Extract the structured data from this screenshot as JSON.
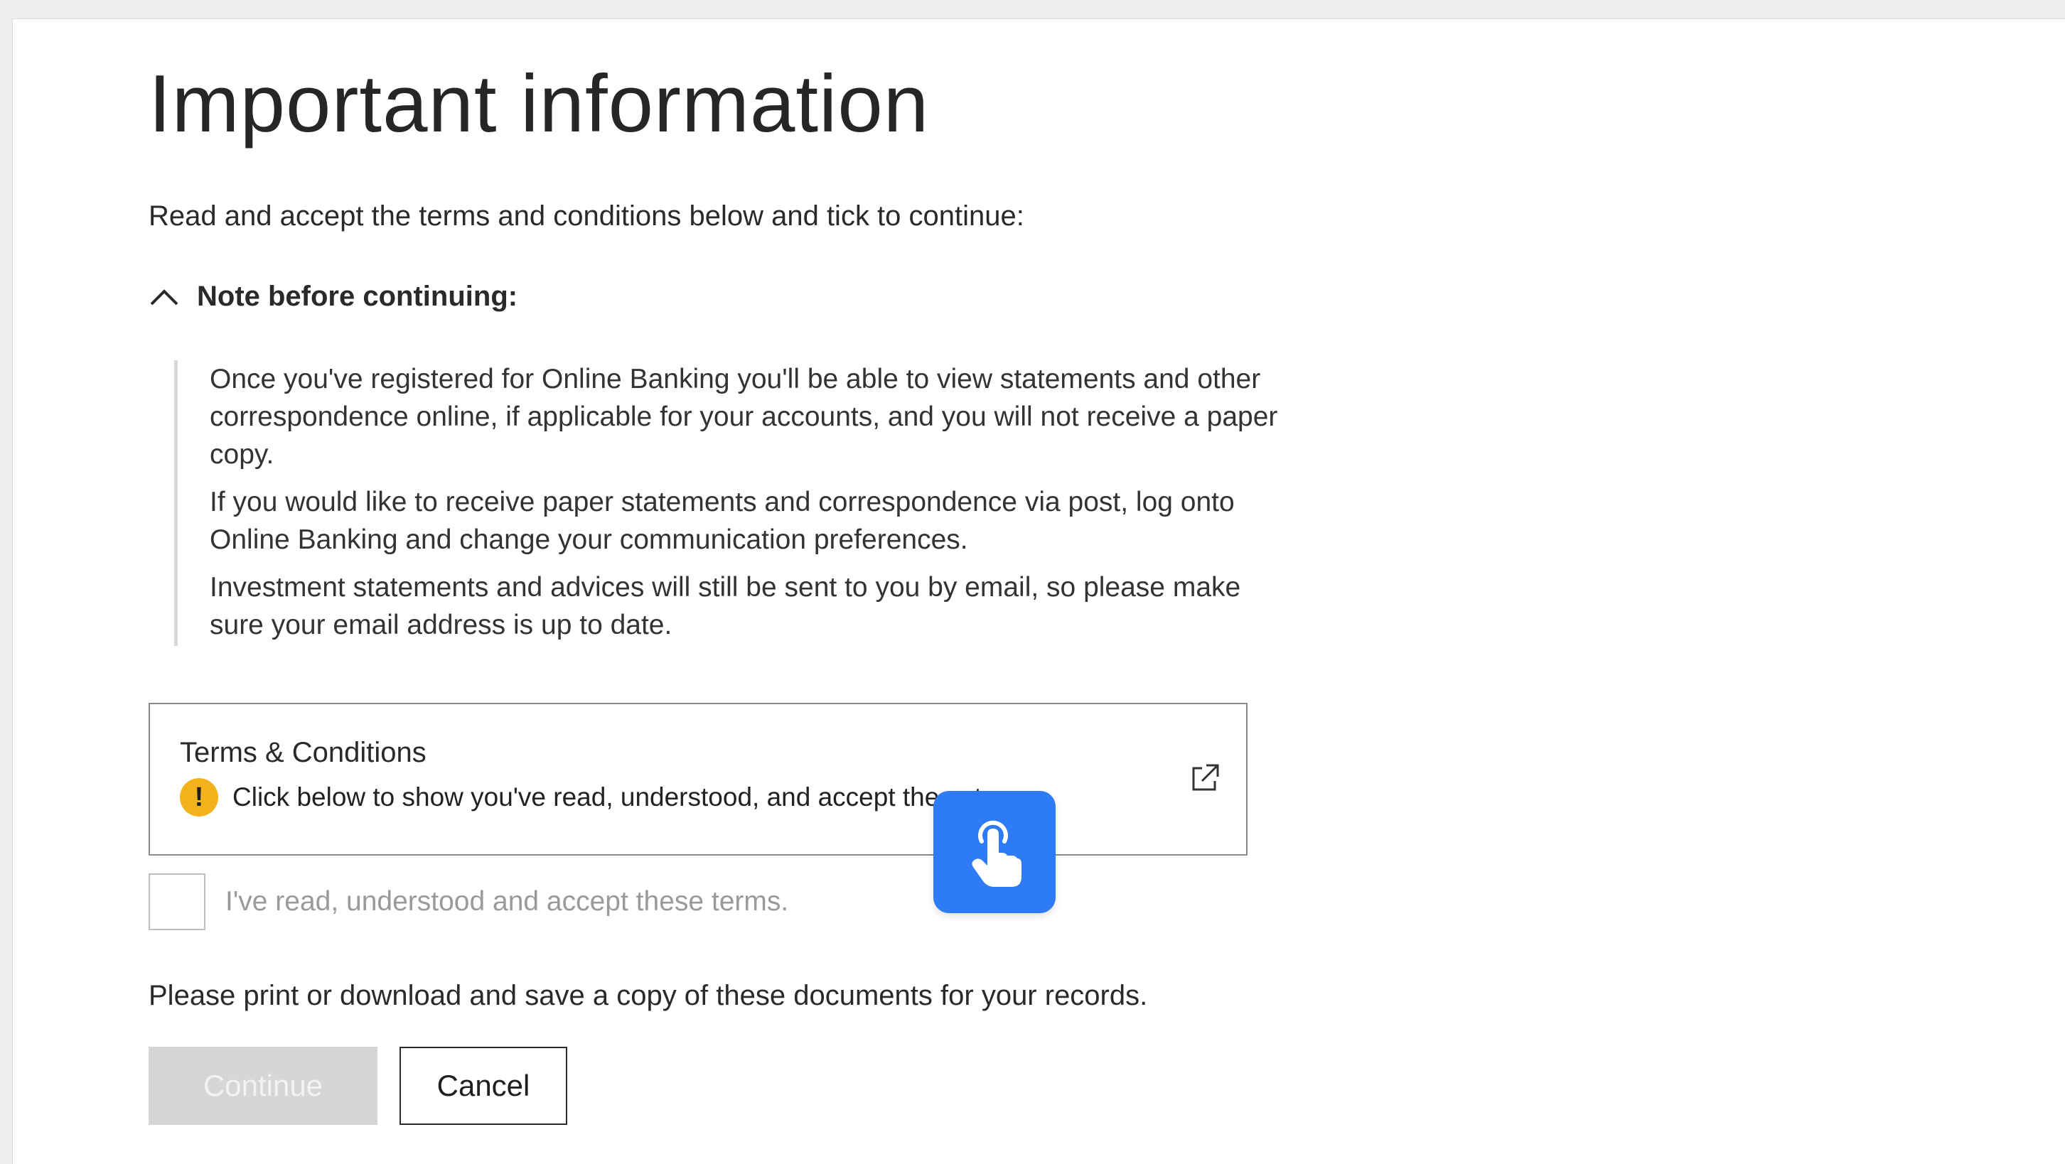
{
  "page": {
    "title": "Important information",
    "intro": "Read and accept the terms and conditions below and tick to continue:"
  },
  "note": {
    "label": "Note before continuing:",
    "expanded": true,
    "paragraphs": [
      "Once you've registered for Online Banking you'll be able to view statements and other correspondence online, if applicable for your accounts, and you will not receive a paper copy.",
      "If you would like to receive paper statements and correspondence via post, log onto Online Banking and change your communication preferences.",
      "Investment statements and advices will still be sent to you by email, so please make sure your email address is up to date."
    ]
  },
  "terms": {
    "title": "Terms & Conditions",
    "warning": "Click below to show you've read, understood, and accept these terms",
    "warning_icon": "exclamation-icon",
    "link_icon": "external-link-icon"
  },
  "accept": {
    "label": "I've read, understood and accept these terms.",
    "checked": false
  },
  "records_note": "Please print or download and save a copy of these documents for your records.",
  "buttons": {
    "continue_label": "Continue",
    "continue_enabled": false,
    "cancel_label": "Cancel"
  },
  "colors": {
    "warning": "#f2b21b",
    "tap_hint": "#2d7cf6",
    "disabled_button": "#d6d6d6"
  }
}
